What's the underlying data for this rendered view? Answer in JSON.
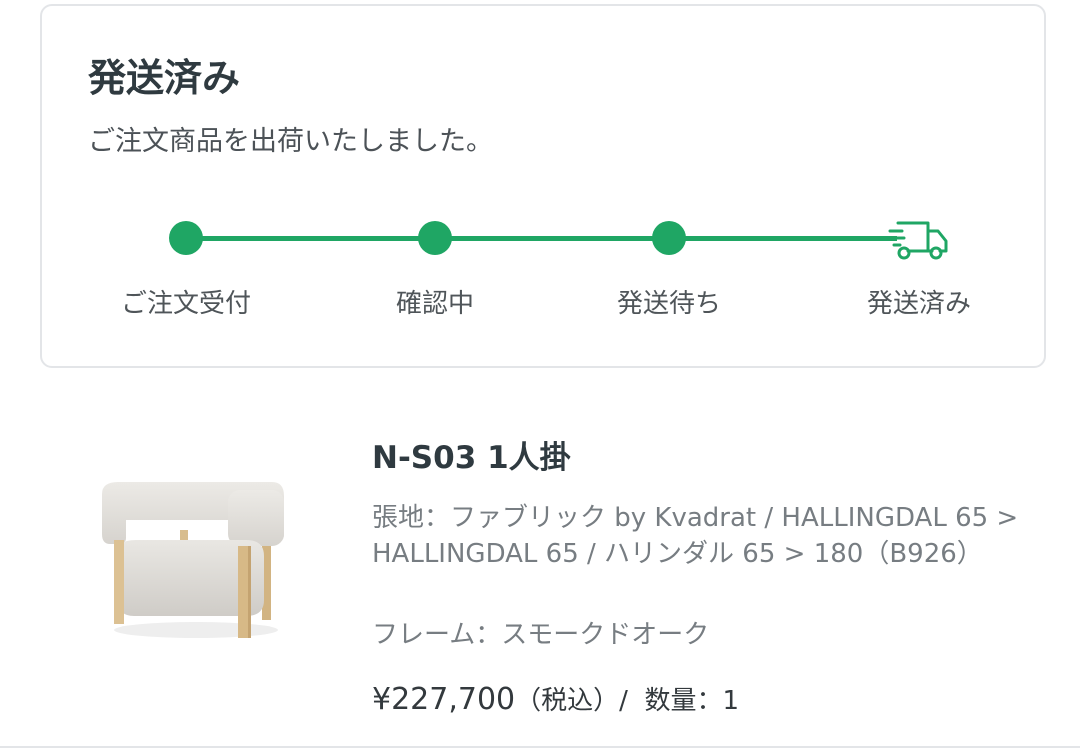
{
  "status": {
    "title": "発送済み",
    "message": "ご注文商品を出荷いたしました。",
    "accent_color": "#1fa664",
    "steps": [
      {
        "label": "ご注文受付",
        "state": "done",
        "icon": "dot"
      },
      {
        "label": "確認中",
        "state": "done",
        "icon": "dot"
      },
      {
        "label": "発送待ち",
        "state": "done",
        "icon": "dot"
      },
      {
        "label": "発送済み",
        "state": "current",
        "icon": "truck-icon"
      }
    ]
  },
  "product": {
    "name": "N-S03 1人掛",
    "fabric": "張地：ファブリック by Kvadrat / HALLINGDAL 65 > HALLINGDAL 65 / ハリンダル 65 > 180（B926）",
    "frame": "フレーム：スモークドオーク",
    "price": "¥227,700",
    "tax_note": "（税込）/",
    "quantity_label": "数量：1",
    "image_icon": "armchair-image"
  }
}
